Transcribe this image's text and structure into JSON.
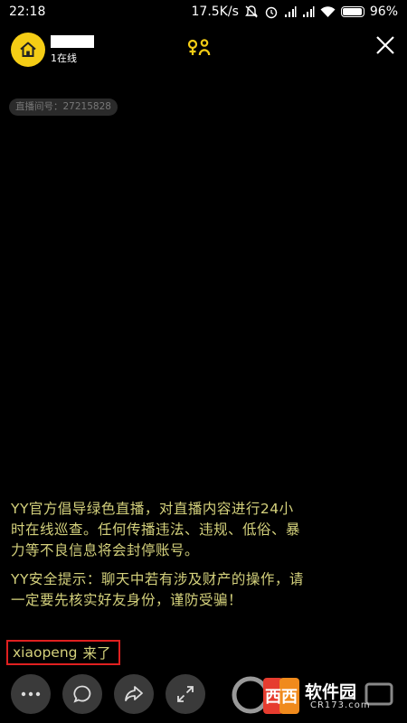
{
  "status_bar": {
    "time": "22:18",
    "network_speed": "17.5K/s",
    "battery_percent": "96%",
    "battery_level": 0.96
  },
  "header": {
    "online_count": "1在线",
    "room_id": "直播间号：27215828"
  },
  "chat": {
    "notice_1": "YY官方倡导绿色直播，对直播内容进行24小时在线巡查。任何传播违法、违规、低俗、暴力等不良信息将会封停账号。",
    "notice_2": "YY安全提示：聊天中若有涉及财产的操作，请一定要先核实好友身份，谨防受骗！",
    "enter_user": "xiaopeng",
    "enter_suffix": "来了"
  },
  "watermark": {
    "text": "软件园",
    "url": "CR173.com"
  },
  "colors": {
    "accent": "#f5cd15",
    "chat_text": "#d4d17c",
    "highlight_border": "#e02020"
  }
}
